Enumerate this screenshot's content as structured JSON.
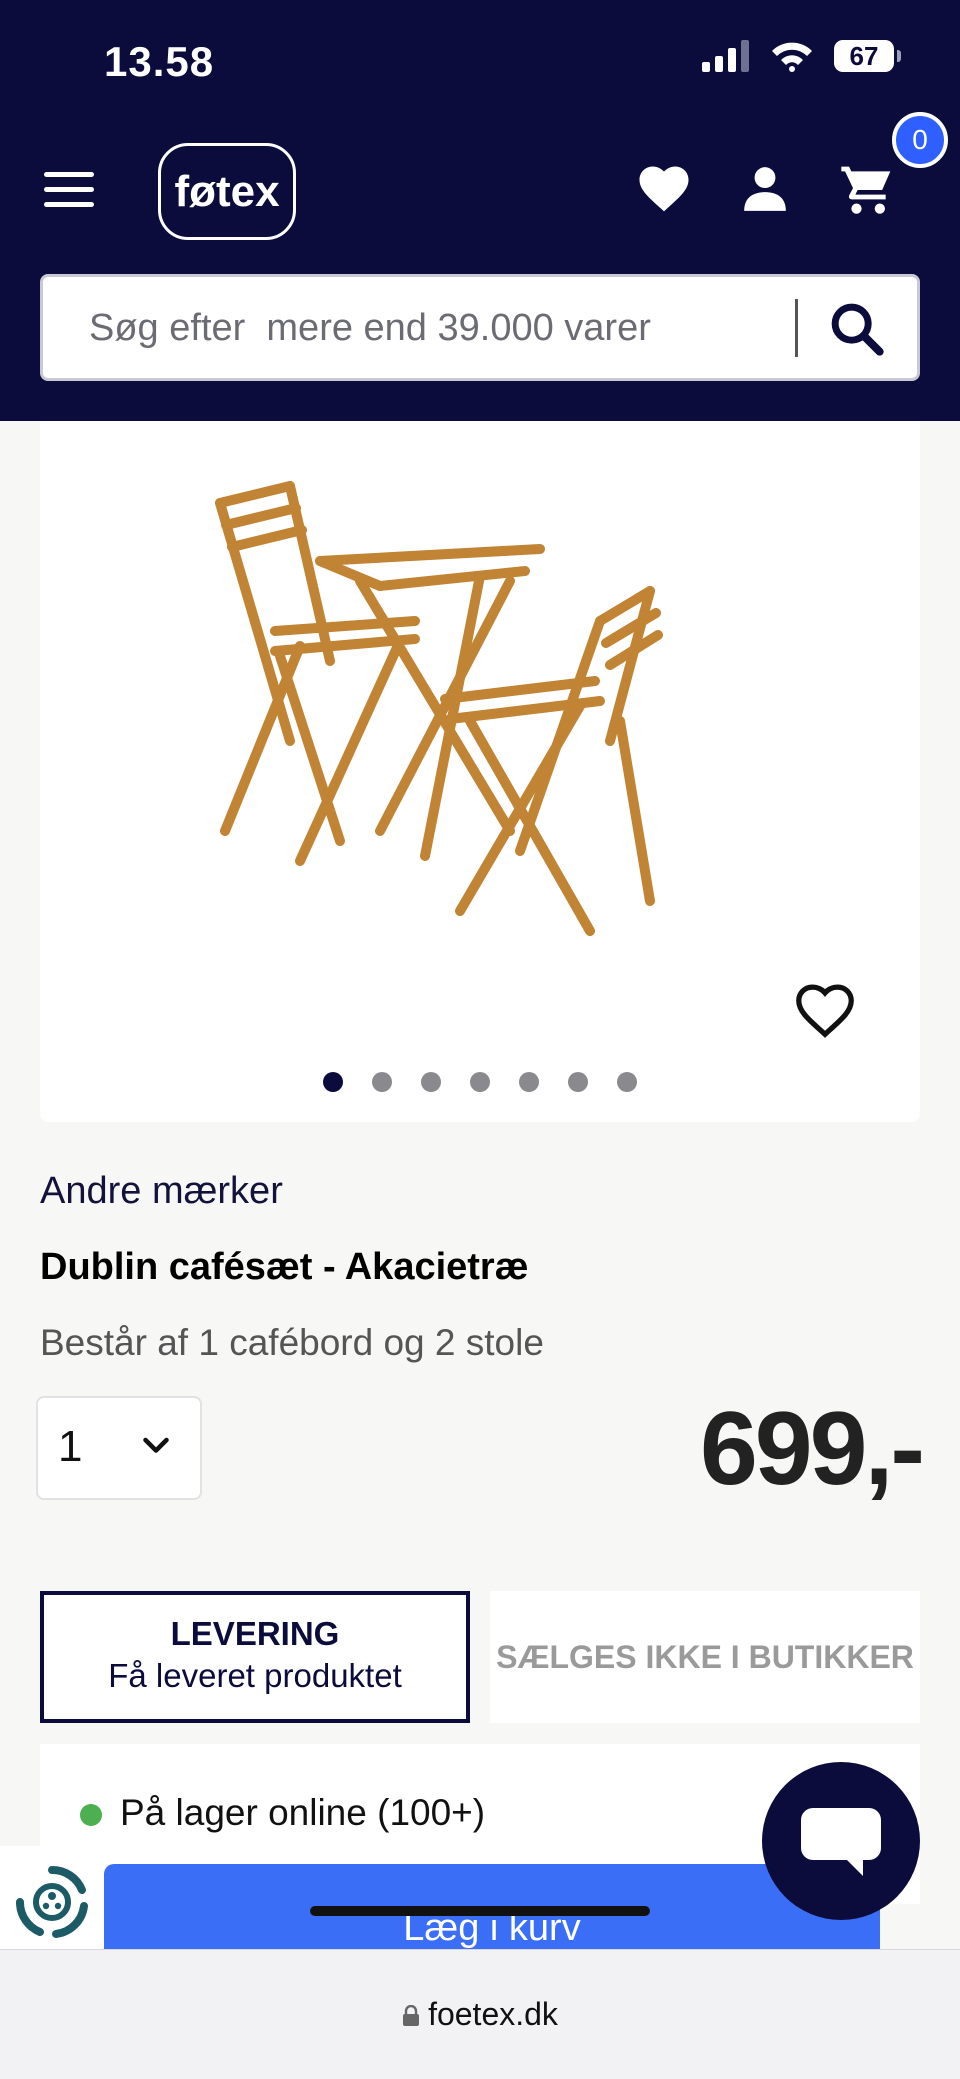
{
  "status_bar": {
    "time": "13.58",
    "battery": "67"
  },
  "header": {
    "logo": "føtex",
    "cart_count": "0",
    "search": {
      "placeholder": "Søg efter  mere end 39.000 varer"
    }
  },
  "gallery": {
    "dot_count": 7,
    "active_index": 0
  },
  "product": {
    "brand": "Andre mærker",
    "title": "Dublin cafésæt - Akacietræ",
    "description": "Består af 1 cafébord og 2 stole",
    "quantity": "1",
    "price": "699,-"
  },
  "delivery_tabs": {
    "delivery_title": "LEVERING",
    "delivery_subtitle": "Få leveret produktet",
    "store_label": "SÆLGES IKKE I BUTIKKER"
  },
  "stock": {
    "text": "På lager online (100+)",
    "status_color": "#4caf50"
  },
  "cta": {
    "add_to_cart": "Læg i kurv"
  },
  "browser": {
    "url": "foetex.dk"
  },
  "colors": {
    "brand_navy": "#0b0c3c",
    "accent_blue": "#3b6ef7"
  }
}
